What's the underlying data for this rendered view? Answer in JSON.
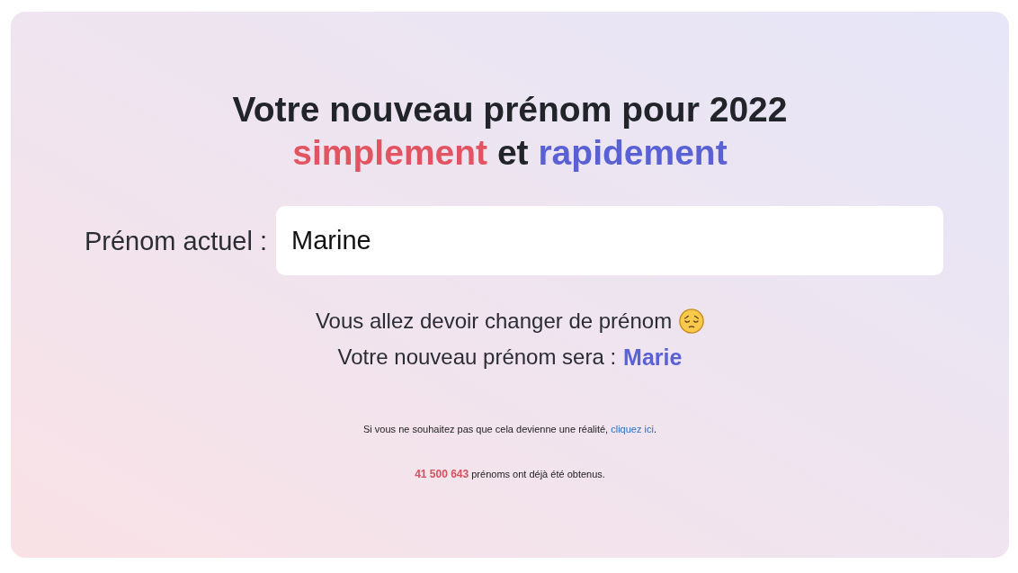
{
  "heading": {
    "title": "Votre nouveau prénom pour 2022",
    "subtitle": [
      {
        "text": "simplement",
        "color": "#e35462"
      },
      {
        "text": "et",
        "color": "#212529"
      },
      {
        "text": "rapidement",
        "color": "#5961d4"
      }
    ]
  },
  "name_form": {
    "label": "Prénom actuel :",
    "value": "Marine"
  },
  "result": {
    "message": "Vous allez devoir changer de prénom",
    "new_name_label": "Votre nouveau prénom sera :",
    "new_name": "Marie"
  },
  "notice": {
    "text": "Si vous ne souhaitez pas que cela devienne une réalité,",
    "link": "cliquez ici",
    "end": "."
  },
  "counter": {
    "count": "41 500 643",
    "text": "prénoms ont déjà été obtenus."
  }
}
